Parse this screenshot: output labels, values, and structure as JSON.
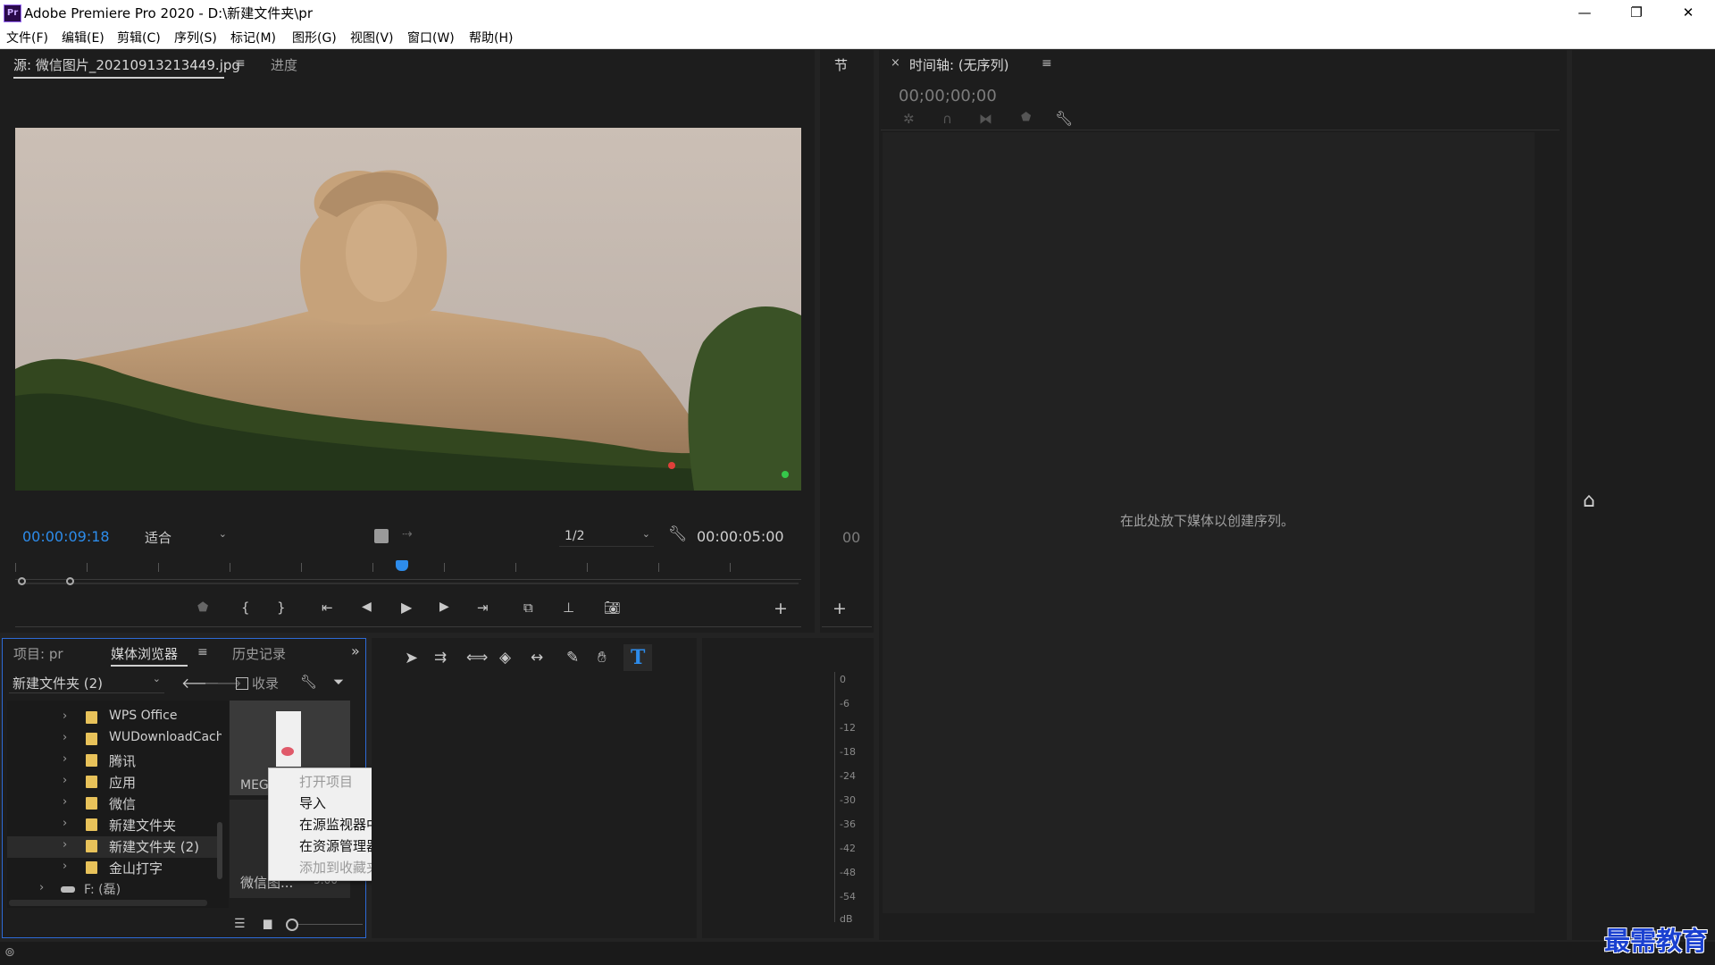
{
  "window": {
    "title": "Adobe Premiere Pro 2020 - D:\\新建文件夹\\pr",
    "logo_text": "Pr",
    "controls": [
      "—",
      "❐",
      "✕"
    ]
  },
  "menu": [
    "文件(F)",
    "编辑(E)",
    "剪辑(C)",
    "序列(S)",
    "标记(M)",
    "图形(G)",
    "视图(V)",
    "窗口(W)",
    "帮助(H)"
  ],
  "source_monitor": {
    "tab_source": "源: 微信图片_20210913213449.jpg",
    "tab_progress": "进度",
    "timecode_current": "00:00:09:18",
    "zoom_select": "适合",
    "resolution_select": "1/2",
    "timecode_duration": "00:00:05:00",
    "image_alt": "statue photo"
  },
  "section_panel": {
    "tab": "节",
    "counter": "00"
  },
  "timeline": {
    "tab": "时间轴: (无序列)",
    "timecode": "00;00;00;00",
    "empty_message": "在此处放下媒体以创建序列。"
  },
  "project_panel": {
    "tab_project": "项目: pr",
    "tab_media_browser": "媒体浏览器",
    "tab_history": "历史记录",
    "folder_select": "新建文件夹 (2)",
    "favorites_label": "收录",
    "tree": [
      {
        "label": "WPS Office"
      },
      {
        "label": "WUDownloadCache"
      },
      {
        "label": "腾讯"
      },
      {
        "label": "应用"
      },
      {
        "label": "微信"
      },
      {
        "label": "新建文件夹"
      },
      {
        "label": "新建文件夹 (2)"
      },
      {
        "label": "金山打字"
      }
    ],
    "drive_label": "F: (磊)",
    "thumb1_label": "MEGA",
    "thumb2_label": "微信图...",
    "thumb2_duration": "5:00"
  },
  "context_menu": {
    "items": [
      {
        "label": "打开项目",
        "enabled": false
      },
      {
        "label": "导入",
        "enabled": true
      },
      {
        "label": "在源监视器中打开",
        "enabled": true
      },
      {
        "label": "在资源管理器中显示",
        "enabled": true
      },
      {
        "label": "添加到收藏夹",
        "enabled": false
      }
    ]
  },
  "audio_meter": {
    "scale": [
      "0",
      "-6",
      "-12",
      "-18",
      "-24",
      "-30",
      "-36",
      "-42",
      "-48",
      "-54",
      "dB"
    ]
  },
  "watermark": "最需教育",
  "colors": {
    "accent_blue": "#2d8ceb",
    "panel_bg": "#1d1d1d",
    "app_bg": "#232323",
    "panel_border_active": "#2d6ad6"
  }
}
